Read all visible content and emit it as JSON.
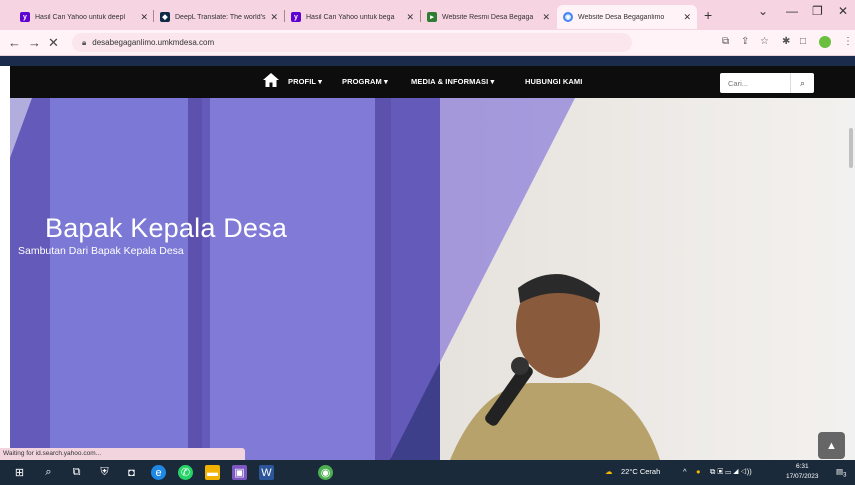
{
  "browser": {
    "tabs": [
      {
        "title": "Hasil Cari Yahoo untuk deepl",
        "icon": "yahoo-icon",
        "color": "#5f01d1"
      },
      {
        "title": "DeepL Translate: The world's",
        "icon": "deepl-icon",
        "color": "#0f2b46"
      },
      {
        "title": "Hasil Cari Yahoo untuk bega",
        "icon": "yahoo-icon",
        "color": "#5f01d1"
      },
      {
        "title": "Website Resmi Desa Begaga",
        "icon": "site-icon",
        "color": "#2e7d32"
      },
      {
        "title": "Website Desa Begaganlimo",
        "icon": "chrome-icon",
        "color": "#4285f4"
      }
    ],
    "active_tab_index": 4,
    "url": "desabegaganlimo.umkmdesa.com",
    "status_text": "Waiting for id.search.yahoo.com..."
  },
  "site": {
    "nav": [
      {
        "label": "PROFIL",
        "dropdown": true
      },
      {
        "label": "PROGRAM",
        "dropdown": true
      },
      {
        "label": "MEDIA & INFORMASI",
        "dropdown": true
      },
      {
        "label": "HUBUNGI KAMI",
        "dropdown": false
      }
    ],
    "search_placeholder": "Cari...",
    "hero": {
      "title": "Bapak Kepala Desa",
      "subtitle": "Sambutan Dari Bapak Kepala Desa"
    },
    "accent_color": "#7b6bd8",
    "nav_color": "#0d0d0d"
  },
  "taskbar": {
    "weather": "22°C  Cerah",
    "time": "6:31",
    "date": "17/07/2023",
    "notification_count": "3"
  }
}
